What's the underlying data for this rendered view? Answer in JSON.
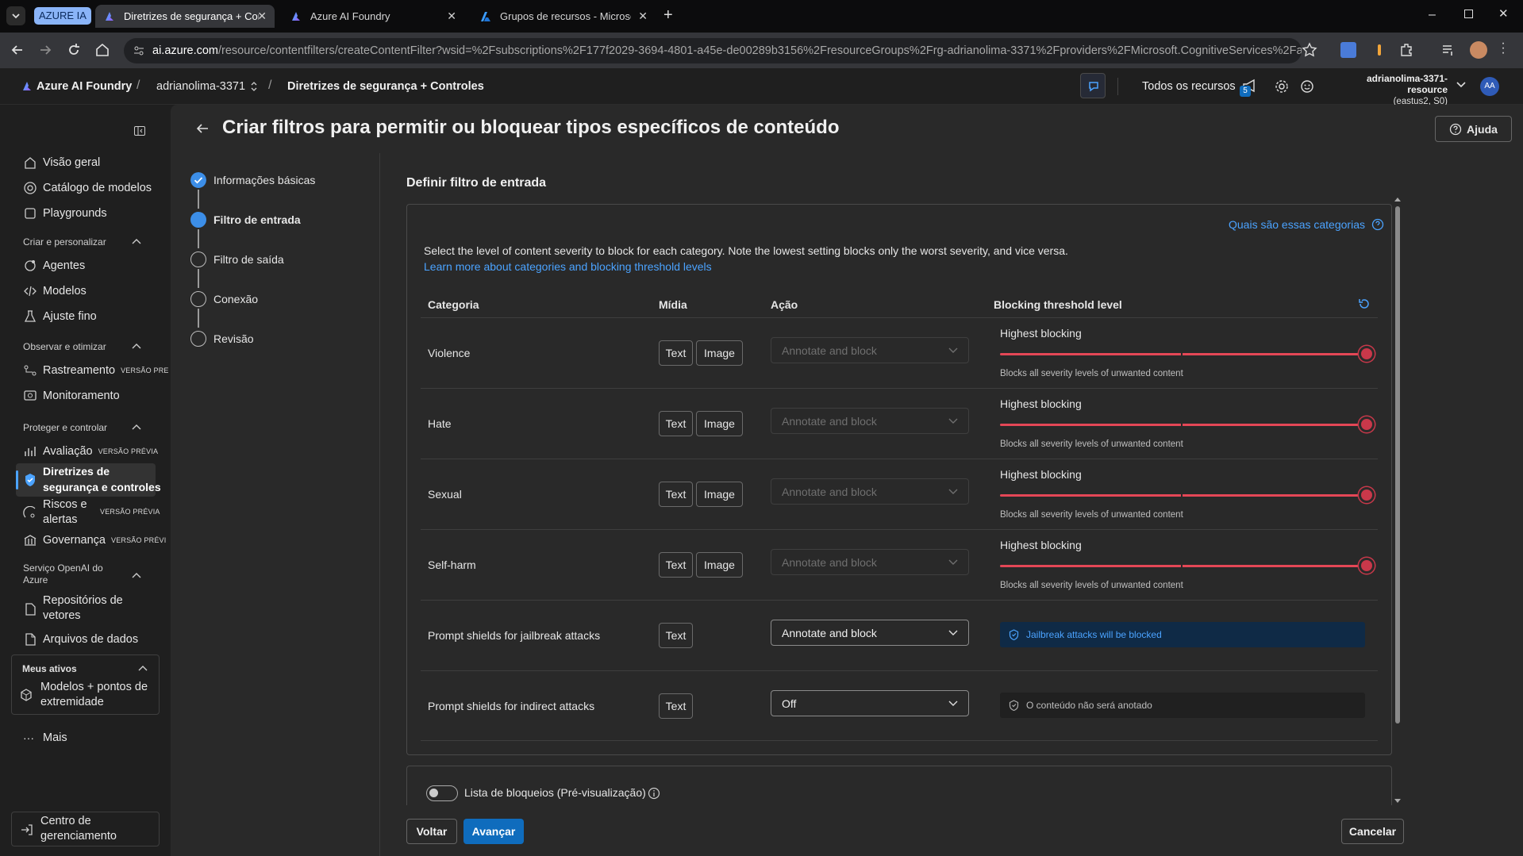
{
  "browser": {
    "group_label": "AZURE IA",
    "tabs": [
      {
        "title": "Diretrizes de segurança + Cont"
      },
      {
        "title": "Azure AI Foundry"
      },
      {
        "title": "Grupos de recursos - Microsoft"
      }
    ],
    "url_host": "ai.azure.com",
    "url_path": "/resource/contentfilters/createContentFilter?wsid=%2Fsubscriptions%2F177f2029-3694-4801-a45e-de00289b3156%2FresourceGroups%2Frg-adrianolima-3371%2Fproviders%2FMicrosoft.CognitiveServices%2Faccounts..."
  },
  "header": {
    "app_name": "Azure AI Foundry",
    "project": "adrianolima-3371",
    "page": "Diretrizes de segurança + Controles",
    "all_resources": "Todos os recursos",
    "notification_count": "5",
    "resource_name": "adrianolima-3371-resource",
    "resource_region": "(eastus2, S0)",
    "avatar_initials": "AA"
  },
  "sidebar": {
    "top_items": [
      "Visão geral",
      "Catálogo de modelos",
      "Playgrounds"
    ],
    "section_create": "Criar e personalizar",
    "create_items": [
      "Agentes",
      "Modelos",
      "Ajuste fino"
    ],
    "section_observe": "Observar e otimizar",
    "observe_items": [
      "Rastreamento",
      "Monitoramento"
    ],
    "preview_badge_short": "VERSÃO PRE",
    "section_protect": "Proteger e controlar",
    "protect_eval": "Avaliação",
    "preview_badge": "VERSÃO PRÉVIA",
    "protect_active_1": "Diretrizes de",
    "protect_active_2": "segurança e controles",
    "risks_1": "Riscos e",
    "risks_2": "alertas",
    "governance": "Governança",
    "preview_badge_gov": "VERSÃO PRÉVI",
    "section_openai_1": "Serviço OpenAI do",
    "section_openai_2": "Azure",
    "vector_1": "Repositórios de",
    "vector_2": "vetores",
    "datafiles": "Arquivos de dados",
    "my_assets": "Meus ativos",
    "models_endpoints_1": "Modelos + pontos de",
    "models_endpoints_2": "extremidade",
    "more": "Mais",
    "management_1": "Centro de",
    "management_2": "gerenciamento"
  },
  "page": {
    "title": "Criar filtros para permitir ou bloquear tipos específicos de conteúdo",
    "help": "Ajuda",
    "steps": [
      "Informações básicas",
      "Filtro de entrada",
      "Filtro de saída",
      "Conexão",
      "Revisão"
    ],
    "section_title": "Definir filtro de entrada",
    "categories_link": "Quais são essas categorias",
    "description": "Select the level of content severity to block for each category. Note the lowest setting blocks only the worst severity, and vice versa.",
    "learn_more": "Learn more about categories and blocking threshold levels",
    "columns": {
      "category": "Categoria",
      "media": "Mídia",
      "action": "Ação",
      "threshold": "Blocking threshold level"
    },
    "media_text": "Text",
    "media_image": "Image",
    "severity_rows": [
      {
        "category": "Violence",
        "action": "Annotate and block",
        "level": "Highest blocking",
        "level_desc": "Blocks all severity levels of unwanted content",
        "slider": 1.0
      },
      {
        "category": "Hate",
        "action": "Annotate and block",
        "level": "Highest blocking",
        "level_desc": "Blocks all severity levels of unwanted content",
        "slider": 1.0
      },
      {
        "category": "Sexual",
        "action": "Annotate and block",
        "level": "Highest blocking",
        "level_desc": "Blocks all severity levels of unwanted content",
        "slider": 1.0
      },
      {
        "category": "Self-harm",
        "action": "Annotate and block",
        "level": "Highest blocking",
        "level_desc": "Blocks all severity levels of unwanted content",
        "slider": 1.0
      }
    ],
    "shield_rows": [
      {
        "category": "Prompt shields for jailbreak attacks",
        "action": "Annotate and block",
        "info": "Jailbreak attacks will be blocked"
      },
      {
        "category": "Prompt shields for indirect attacks",
        "action": "Off",
        "info": "O conteúdo não será anotado"
      }
    ],
    "blocklist_label": "Lista de bloqueios (Pré-visualização)",
    "back": "Voltar",
    "next": "Avançar",
    "cancel": "Cancelar"
  },
  "colors": {
    "accent": "#0f6cbd",
    "danger": "#e44756",
    "link": "#4ba3ff"
  }
}
